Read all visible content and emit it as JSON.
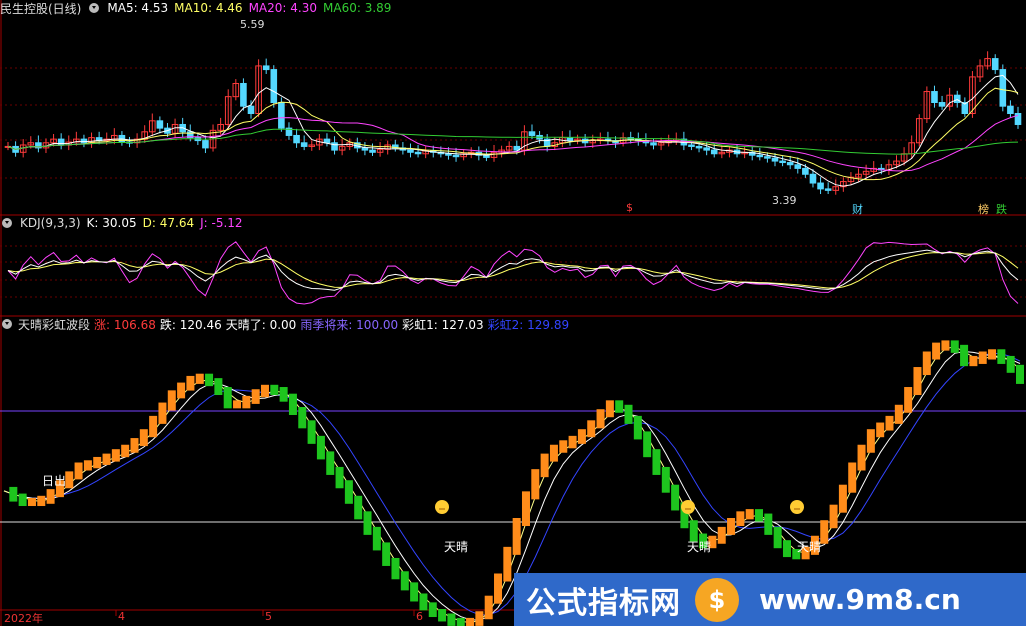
{
  "panel1": {
    "title": "民生控股(日线)",
    "ma5": "MA5: 4.53",
    "ma10": "MA10: 4.46",
    "ma20": "MA20: 4.30",
    "ma60": "MA60: 3.89",
    "high_label": "5.59",
    "low_label": "3.39",
    "tags": [
      "$",
      "财",
      "榜",
      "跌"
    ]
  },
  "panel2": {
    "title": "KDJ(9,3,3)",
    "k": "K: 30.05",
    "d": "D: 47.64",
    "j": "J: -5.12"
  },
  "panel3": {
    "title": "天晴彩虹波段",
    "zhang": "涨: 106.68",
    "die": "跌: 120.46",
    "tianqing": "天晴了: 0.00",
    "yuji": "雨季将来: 100.00",
    "caihong1": "彩虹1: 127.03",
    "caihong2": "彩虹2: 129.89",
    "rising_label": "日出",
    "sunny_label": "天晴",
    "levels": [
      100,
      0
    ]
  },
  "x_axis": [
    "2022年",
    "4",
    "5",
    "6"
  ],
  "watermark": {
    "left": "公式指标网",
    "right": "www.9m8.cn"
  },
  "colors": {
    "up": "#ff3b3b",
    "down": "#54d8ff",
    "ma5": "#ffffff",
    "ma10": "#ffff66",
    "ma20": "#ff44ff",
    "ma60": "#33cc33",
    "k": "#ffffff",
    "d": "#ffff66",
    "j": "#ff44ff",
    "orange": "#ff8c1a",
    "green": "#1ec51e",
    "blue": "#3344ff"
  },
  "chart_data": [
    {
      "type": "candlestick",
      "title": "民生控股(日线)",
      "series": [
        {
          "name": "MA5",
          "value": 4.53
        },
        {
          "name": "MA10",
          "value": 4.46
        },
        {
          "name": "MA20",
          "value": 4.3
        },
        {
          "name": "MA60",
          "value": 3.89
        }
      ],
      "annotations": [
        {
          "label": "5.59",
          "kind": "high"
        },
        {
          "label": "3.39",
          "kind": "low"
        }
      ],
      "close_approx": [
        4.0,
        3.92,
        4.02,
        4.05,
        3.98,
        4.05,
        4.1,
        4.02,
        4.06,
        4.1,
        4.05,
        4.12,
        4.08,
        4.1,
        4.15,
        4.06,
        4.05,
        4.1,
        4.2,
        4.35,
        4.25,
        4.18,
        4.3,
        4.2,
        4.12,
        4.08,
        3.98,
        4.22,
        4.3,
        4.68,
        4.86,
        4.55,
        4.45,
        5.1,
        5.05,
        4.6,
        4.25,
        4.15,
        4.05,
        4.0,
        4.02,
        4.1,
        4.05,
        3.95,
        4.0,
        4.05,
        3.98,
        3.95,
        3.92,
        3.96,
        4.02,
        3.98,
        3.95,
        3.92,
        3.9,
        3.94,
        3.92,
        3.9,
        3.88,
        3.86,
        3.9,
        3.92,
        3.88,
        3.85,
        3.92,
        3.95,
        4.0,
        3.95,
        4.2,
        4.15,
        4.1,
        4.0,
        4.05,
        4.12,
        4.08,
        4.1,
        4.05,
        4.08,
        4.1,
        4.08,
        4.05,
        4.12,
        4.1,
        4.08,
        4.05,
        4.02,
        4.05,
        4.08,
        4.1,
        4.02,
        4.0,
        3.98,
        3.95,
        3.9,
        3.92,
        3.95,
        3.9,
        3.92,
        3.88,
        3.86,
        3.84,
        3.8,
        3.78,
        3.75,
        3.7,
        3.62,
        3.5,
        3.42,
        3.4,
        3.45,
        3.52,
        3.58,
        3.62,
        3.66,
        3.7,
        3.68,
        3.75,
        3.8,
        3.9,
        4.05,
        4.38,
        4.75,
        4.6,
        4.55,
        4.7,
        4.6,
        4.45,
        4.95,
        5.1,
        5.2,
        5.05,
        4.55,
        4.45,
        4.3
      ]
    },
    {
      "type": "line",
      "title": "KDJ(9,3,3)",
      "series": [
        {
          "name": "K",
          "last": 30.05
        },
        {
          "name": "D",
          "last": 47.64
        },
        {
          "name": "J",
          "last": -5.12
        }
      ]
    },
    {
      "type": "bar",
      "title": "天晴彩虹波段",
      "series": [
        {
          "name": "涨",
          "last": 106.68
        },
        {
          "name": "跌",
          "last": 120.46
        },
        {
          "name": "天晴了",
          "last": 0.0
        },
        {
          "name": "雨季将来",
          "last": 100.0
        },
        {
          "name": "彩虹1",
          "last": 127.03
        },
        {
          "name": "彩虹2",
          "last": 129.89
        }
      ],
      "hlines": [
        100,
        0
      ],
      "wave_approx": [
        28,
        22,
        18,
        18,
        20,
        26,
        34,
        42,
        50,
        52,
        55,
        58,
        62,
        66,
        72,
        80,
        92,
        104,
        115,
        122,
        128,
        130,
        126,
        118,
        106,
        106,
        110,
        116,
        120,
        118,
        112,
        100,
        88,
        74,
        60,
        46,
        34,
        20,
        6,
        -8,
        -22,
        -36,
        -48,
        -58,
        -68,
        -76,
        -82,
        -86,
        -90,
        -92,
        -90,
        -84,
        -70,
        -50,
        -26,
        0,
        24,
        44,
        58,
        66,
        70,
        74,
        80,
        88,
        98,
        106,
        102,
        92,
        78,
        62,
        46,
        30,
        14,
        -2,
        -14,
        -20,
        -16,
        -8,
        0,
        6,
        8,
        4,
        -8,
        -20,
        -28,
        -30,
        -26,
        -16,
        -2,
        12,
        30,
        50,
        66,
        80,
        86,
        92,
        102,
        118,
        136,
        150,
        158,
        160,
        156,
        144,
        146,
        150,
        152,
        146,
        138,
        128
      ],
      "markers": [
        {
          "label": "日出"
        },
        {
          "label": "天晴"
        },
        {
          "label": "天晴"
        },
        {
          "label": "天晴"
        }
      ]
    }
  ]
}
